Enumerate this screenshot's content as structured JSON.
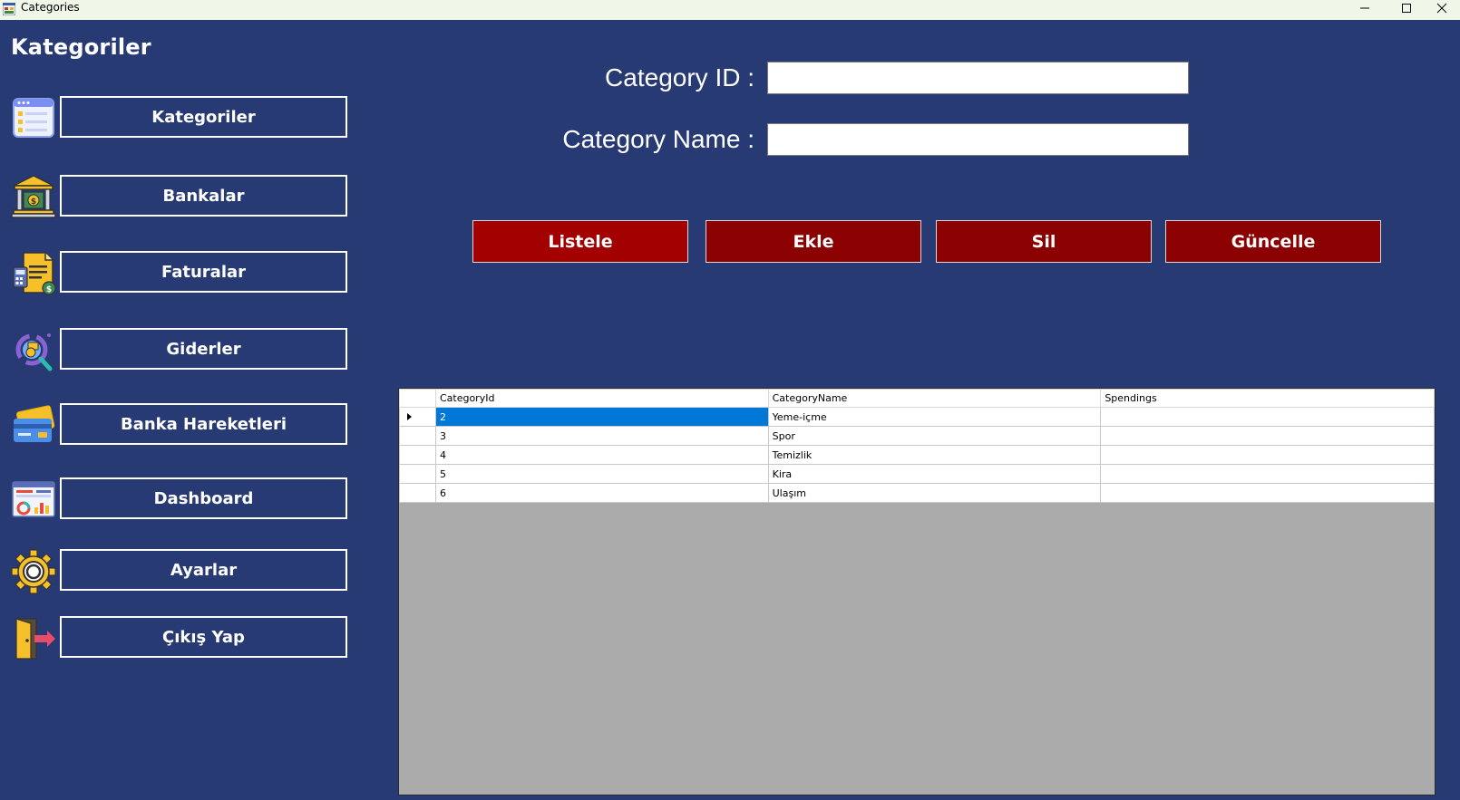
{
  "window": {
    "title": "Categories"
  },
  "sidebar": {
    "heading": "Kategoriler",
    "items": [
      {
        "label": "Kategoriler",
        "icon": "categories-list-icon"
      },
      {
        "label": "Bankalar",
        "icon": "bank-building-icon"
      },
      {
        "label": "Faturalar",
        "icon": "invoice-calculator-icon"
      },
      {
        "label": "Giderler",
        "icon": "expense-magnifier-icon"
      },
      {
        "label": "Banka Hareketleri",
        "icon": "credit-card-icon"
      },
      {
        "label": "Dashboard",
        "icon": "dashboard-chart-icon"
      },
      {
        "label": "Ayarlar",
        "icon": "gear-icon"
      },
      {
        "label": "Çıkış Yap",
        "icon": "exit-door-icon"
      }
    ]
  },
  "form": {
    "category_id_label": "Category ID :",
    "category_id_value": "",
    "category_name_label": "Category Name :",
    "category_name_value": ""
  },
  "actions": {
    "list": "Listele",
    "add": "Ekle",
    "delete": "Sil",
    "update": "Güncelle"
  },
  "colors": {
    "background": "#273a74",
    "list_button": "#a30000",
    "action_button": "#8b0000",
    "selection": "#0078d7",
    "grid_empty": "#ababab"
  },
  "grid": {
    "columns": [
      "CategoryId",
      "CategoryName",
      "Spendings"
    ],
    "rows": [
      [
        "2",
        "Yeme-içme",
        ""
      ],
      [
        "3",
        "Spor",
        ""
      ],
      [
        "4",
        "Temizlik",
        ""
      ],
      [
        "5",
        "Kira",
        ""
      ],
      [
        "6",
        "Ulaşım",
        ""
      ]
    ]
  }
}
